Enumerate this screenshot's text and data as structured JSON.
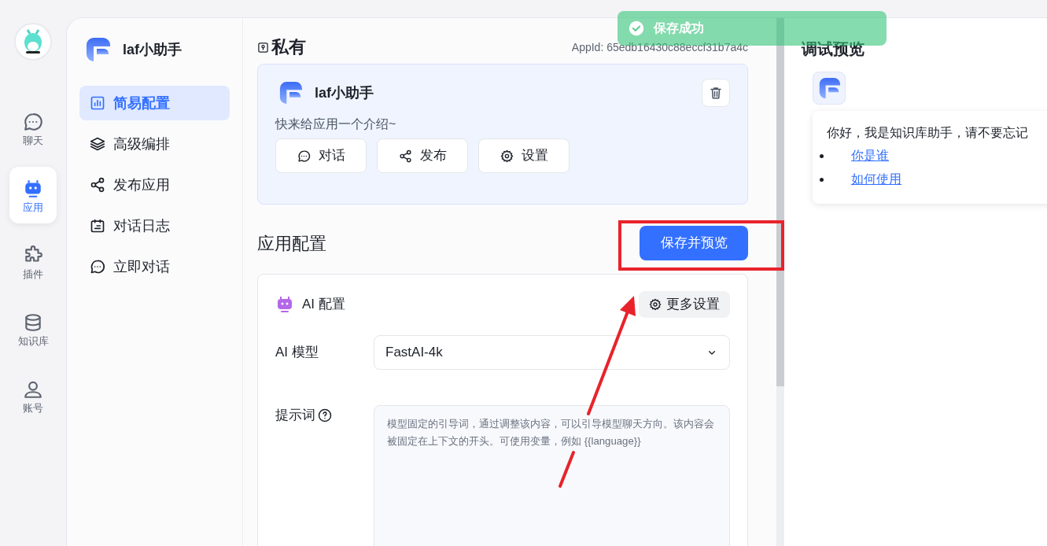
{
  "rail": {
    "items": [
      {
        "label": "聊天",
        "selected": false
      },
      {
        "label": "应用",
        "selected": true
      },
      {
        "label": "插件",
        "selected": false
      },
      {
        "label": "知识库",
        "selected": false
      },
      {
        "label": "账号",
        "selected": false
      }
    ]
  },
  "app_menu": {
    "app_name": "laf小助手",
    "items": [
      {
        "label": "简易配置",
        "selected": true
      },
      {
        "label": "高级编排",
        "selected": false
      },
      {
        "label": "发布应用",
        "selected": false
      },
      {
        "label": "对话日志",
        "selected": false
      },
      {
        "label": "立即对话",
        "selected": false
      }
    ]
  },
  "header": {
    "title": "私有",
    "app_id": "AppId: 65edb16430c88eccf31b7a4c"
  },
  "app_card": {
    "name": "laf小助手",
    "intro": "快来给应用一个介绍~",
    "buttons": [
      "对话",
      "发布",
      "设置"
    ]
  },
  "config": {
    "title": "应用配置",
    "save_button": "保存并预览",
    "ai_section": {
      "title": "AI 配置",
      "more_button": "更多设置",
      "model_label": "AI 模型",
      "model_value": "FastAI-4k",
      "prompt_label": "提示词",
      "prompt_placeholder": "模型固定的引导词，通过调整该内容，可以引导模型聊天方向。该内容会被固定在上下文的开头。可使用变量，例如 {{language}}"
    }
  },
  "preview": {
    "title": "调试预览",
    "greeting": "你好，我是知识库助手，请不要忘记",
    "links": [
      "你是谁",
      "如何使用"
    ]
  },
  "toast": {
    "message": "保存成功"
  }
}
